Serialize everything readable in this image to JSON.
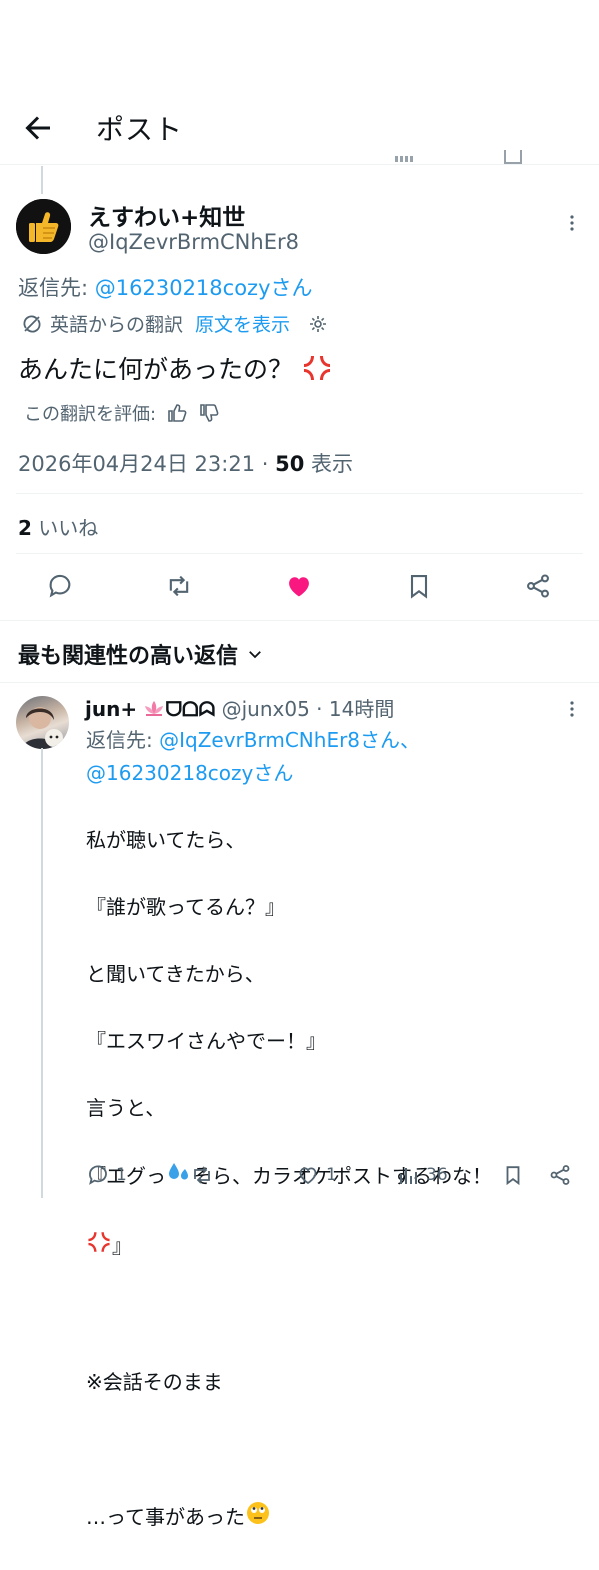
{
  "header": {
    "title": "ポスト"
  },
  "tweet": {
    "display_name": "えすわい+知世",
    "handle": "@IqZevrBrmCNhEr8",
    "reply_prefix": "返信先: ",
    "reply_to": "@16230218cozyさん",
    "translated_from": "英語からの翻訳",
    "show_original": "原文を表示",
    "text": "あんたに何があったの？",
    "rate_translation": "この翻訳を評価:",
    "timestamp": "2026年04月24日 23:21 · ",
    "views_count": "50",
    "views_label": " 表示",
    "likes_count": "2",
    "likes_label": " いいね"
  },
  "sort": {
    "label": "最も関連性の高い返信"
  },
  "reply": {
    "display_name": "jun+",
    "name_suffix": "ᗜᗝᗣ",
    "handle": "@junx05",
    "time": " · 14時間",
    "reply_prefix": "返信先: ",
    "reply_to_1": "@IqZevrBrmCNhEr8さん、",
    "reply_to_2": "@16230218cozyさん",
    "body_lines": [
      "私が聴いてたら、",
      "『誰が歌ってるん？』",
      "と聞いてきたから、",
      "『エスワイさんやでー！』",
      "言うと、",
      "『エグっ",
      "そら、カラオケポストするわな！",
      "』",
      "",
      "※会話そのまま",
      "",
      "…って事があった"
    ],
    "reply_count": "1",
    "like_count": "1",
    "view_count": "36"
  },
  "colors": {
    "accent": "#1d9bf0",
    "like_active": "#f91880",
    "text": "#0f1419",
    "secondary": "#536471",
    "divider": "#eff3f4"
  }
}
